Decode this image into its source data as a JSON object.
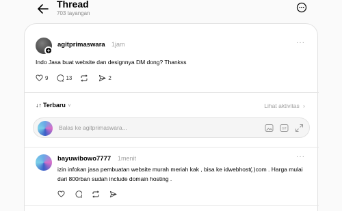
{
  "header": {
    "title": "Thread",
    "views": "703 tayangan"
  },
  "post": {
    "username": "agitprimaswara",
    "time": "1jam",
    "text": "Indo Jasa buat website dan designnya DM dong? Thankss",
    "likes": "9",
    "comments": "13",
    "shares": "2"
  },
  "sort": {
    "label": "Terbaru",
    "activity": "Lihat aktivitas"
  },
  "reply": {
    "placeholder": "Balas ke agitprimaswara..."
  },
  "comment": {
    "username": "bayuwibowo7777",
    "time": "1menit",
    "text": "izin infokan jasa pembuatan website murah meriah kak , bisa ke idwebhost(.)com . Harga mulai dari 800rban sudah include domain hosting ."
  },
  "icons": [
    "back-arrow-icon",
    "more-circle-icon",
    "heart-icon",
    "comment-icon",
    "repost-icon",
    "share-icon",
    "image-icon",
    "gif-icon",
    "expand-icon"
  ]
}
